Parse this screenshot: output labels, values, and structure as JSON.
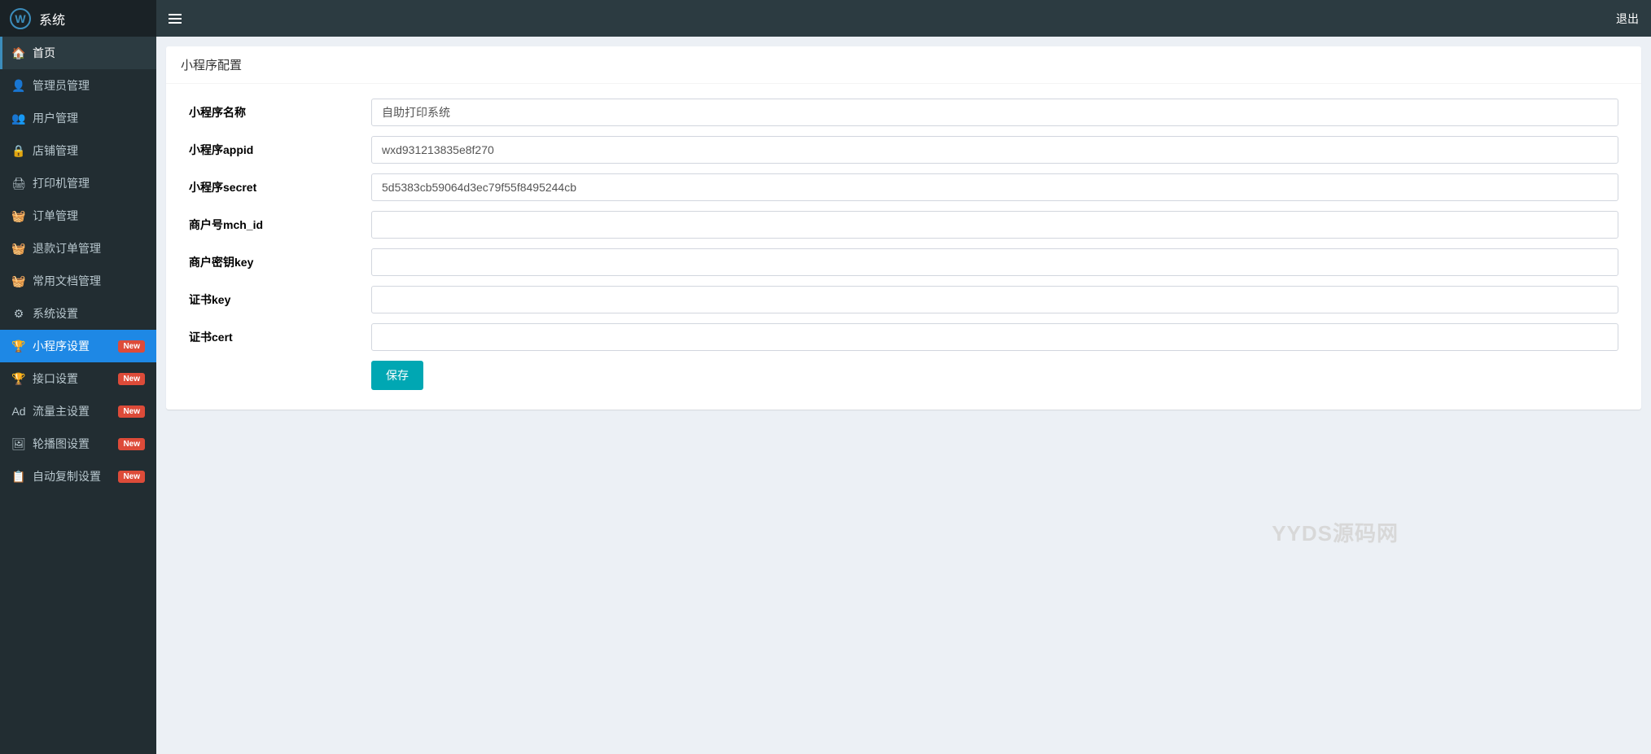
{
  "sidebar": {
    "title": "系统",
    "logo_text": "W",
    "items": [
      {
        "icon": "🏠",
        "label": "首页",
        "active": "home"
      },
      {
        "icon": "👤",
        "label": "管理员管理"
      },
      {
        "icon": "👥",
        "label": "用户管理"
      },
      {
        "icon": "🔒",
        "label": "店铺管理"
      },
      {
        "icon": "🖨",
        "label": "打印机管理"
      },
      {
        "icon": "🧺",
        "label": "订单管理"
      },
      {
        "icon": "🧺",
        "label": "退款订单管理"
      },
      {
        "icon": "🧺",
        "label": "常用文档管理"
      },
      {
        "icon": "⚙",
        "label": "系统设置"
      },
      {
        "icon": "🏆",
        "label": "小程序设置",
        "badge": "New",
        "active": "blue"
      },
      {
        "icon": "🏆",
        "label": "接口设置",
        "badge": "New"
      },
      {
        "icon": "Ad",
        "label": "流量主设置",
        "badge": "New"
      },
      {
        "icon": "🖼",
        "label": "轮播图设置",
        "badge": "New"
      },
      {
        "icon": "📋",
        "label": "自动复制设置",
        "badge": "New"
      }
    ]
  },
  "topbar": {
    "logout": "退出"
  },
  "panel": {
    "title": "小程序配置"
  },
  "form": {
    "fields": [
      {
        "label": "小程序名称",
        "value": "自助打印系统"
      },
      {
        "label": "小程序appid",
        "value": "wxd931213835e8f270"
      },
      {
        "label": "小程序secret",
        "value": "5d5383cb59064d3ec79f55f8495244cb"
      },
      {
        "label": "商户号mch_id",
        "value": ""
      },
      {
        "label": "商户密钥key",
        "value": ""
      },
      {
        "label": "证书key",
        "value": ""
      },
      {
        "label": "证书cert",
        "value": ""
      }
    ],
    "save": "保存"
  },
  "watermark": "YYDS源码网"
}
